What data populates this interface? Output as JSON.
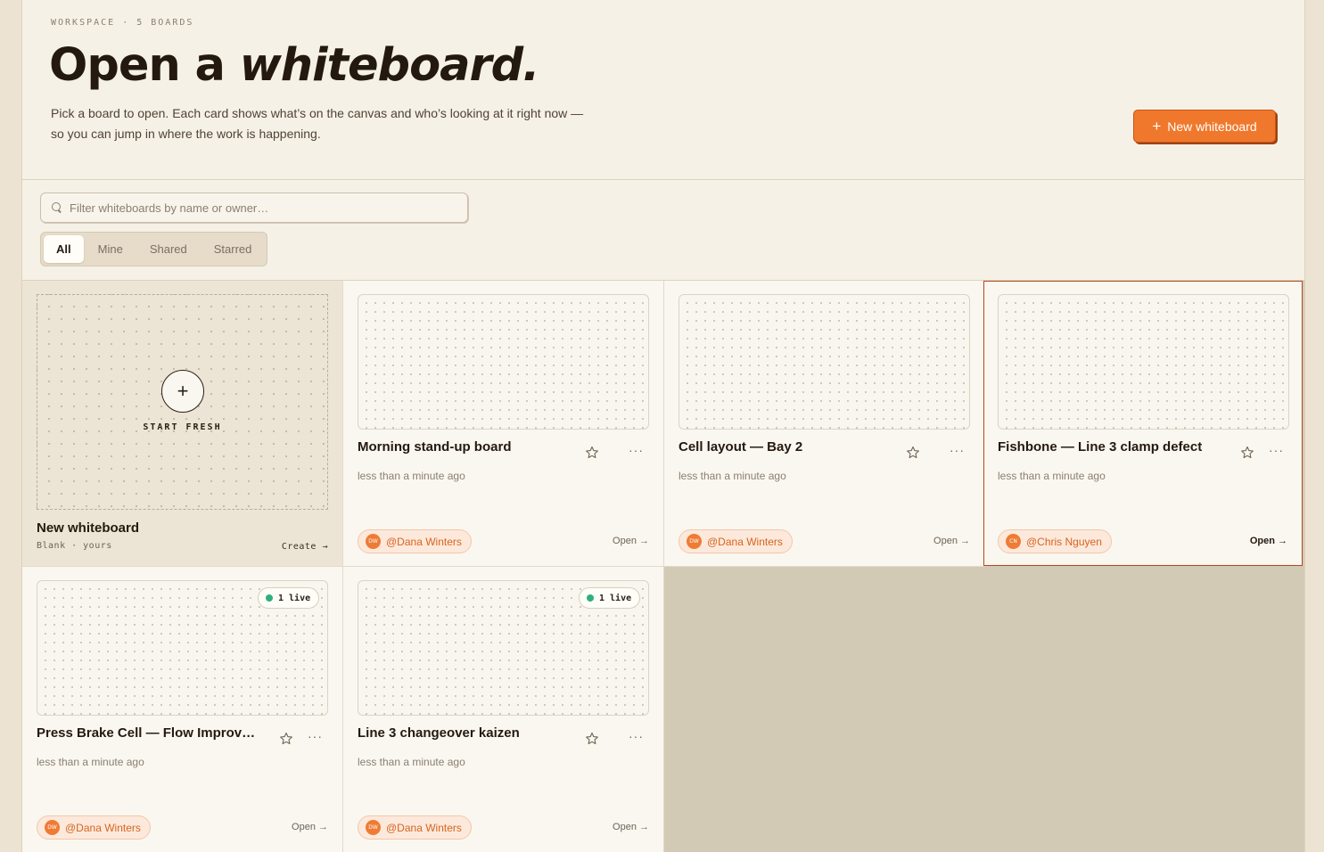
{
  "header": {
    "eyebrow": "WORKSPACE · 5 BOARDS",
    "title_plain": "Open a ",
    "title_emphasis": "whiteboard.",
    "subtitle": "Pick a board to open. Each card shows what’s on the canvas and who’s looking at it right now — so you can jump in where the work is happening.",
    "new_button_label": "New whiteboard"
  },
  "search": {
    "placeholder": "Filter whiteboards by name or owner…",
    "value": ""
  },
  "tabs": [
    {
      "label": "All",
      "active": true
    },
    {
      "label": "Mine",
      "active": false
    },
    {
      "label": "Shared",
      "active": false
    },
    {
      "label": "Starred",
      "active": false
    }
  ],
  "fresh_card": {
    "label": "START FRESH",
    "title": "New whiteboard",
    "meta": "Blank · yours",
    "action": "Create →"
  },
  "boards": [
    {
      "title": "Morning stand-up board",
      "time": "less than a minute ago",
      "owner": "@Dana Winters",
      "initials": "DW",
      "open": "Open →"
    },
    {
      "title": "Cell layout — Bay 2",
      "time": "less than a minute ago",
      "owner": "@Dana Winters",
      "initials": "DW",
      "open": "Open →"
    },
    {
      "title": "Fishbone — Line 3 clamp defect",
      "time": "less than a minute ago",
      "owner": "@Chris Nguyen",
      "initials": "CN",
      "open": "Open →",
      "selected": true
    },
    {
      "title": "Press Brake Cell — Flow Improvement",
      "time": "less than a minute ago",
      "owner": "@Dana Winters",
      "initials": "DW",
      "open": "Open →",
      "live": "1 live"
    },
    {
      "title": "Line 3 changeover kaizen",
      "time": "less than a minute ago",
      "owner": "@Dana Winters",
      "initials": "DW",
      "open": "Open →",
      "live": "1 live"
    }
  ],
  "colors": {
    "accent": "#f0782c",
    "live": "#2fb07a",
    "selected_border": "#b24a1e"
  }
}
